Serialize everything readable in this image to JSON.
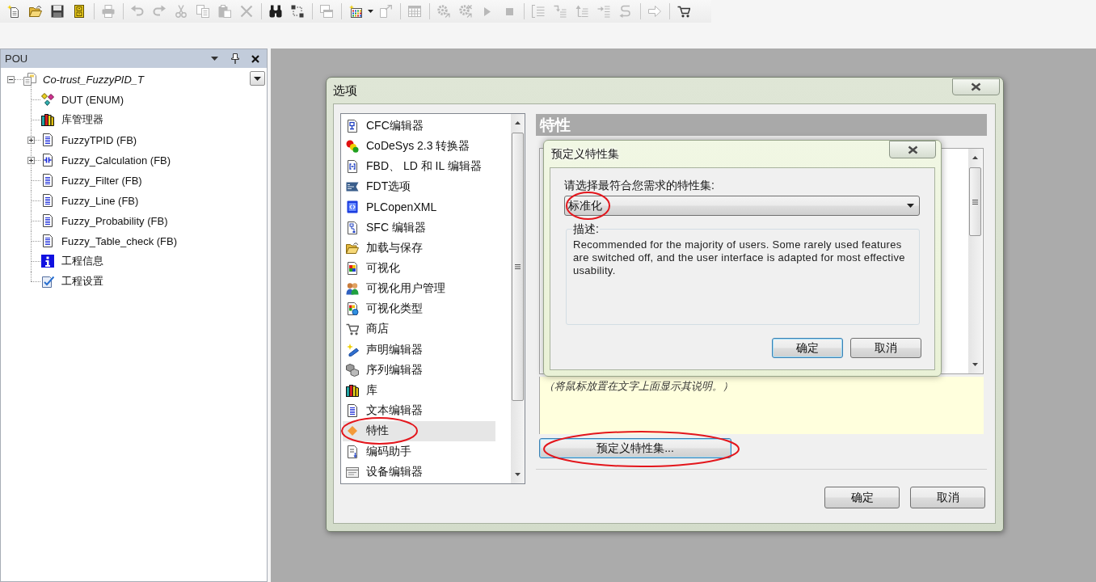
{
  "toolbar": {
    "items": [
      {
        "kind": "new-file",
        "disabled": false
      },
      {
        "kind": "open-folder",
        "disabled": false
      },
      {
        "kind": "save",
        "disabled": false
      },
      {
        "kind": "cabinet",
        "disabled": false
      },
      {
        "kind": "separator"
      },
      {
        "kind": "print",
        "disabled": true
      },
      {
        "kind": "separator"
      },
      {
        "kind": "undo",
        "disabled": true
      },
      {
        "kind": "redo",
        "disabled": true
      },
      {
        "kind": "cut",
        "disabled": true
      },
      {
        "kind": "copy",
        "disabled": true
      },
      {
        "kind": "paste",
        "disabled": true
      },
      {
        "kind": "delete",
        "disabled": true
      },
      {
        "kind": "separator"
      },
      {
        "kind": "find",
        "disabled": false
      },
      {
        "kind": "replace",
        "disabled": false
      },
      {
        "kind": "separator"
      },
      {
        "kind": "windows",
        "disabled": true
      },
      {
        "kind": "separator"
      },
      {
        "kind": "grid-new",
        "disabled": false
      },
      {
        "kind": "caret",
        "disabled": false
      },
      {
        "kind": "page-arrow",
        "disabled": true
      },
      {
        "kind": "separator"
      },
      {
        "kind": "table",
        "disabled": true
      },
      {
        "kind": "separator"
      },
      {
        "kind": "gears",
        "disabled": true
      },
      {
        "kind": "gears-cross",
        "disabled": true
      },
      {
        "kind": "play",
        "disabled": true
      },
      {
        "kind": "stop",
        "disabled": true
      },
      {
        "kind": "separator"
      },
      {
        "kind": "bracket-list",
        "disabled": true
      },
      {
        "kind": "hook-list",
        "disabled": true
      },
      {
        "kind": "up-list",
        "disabled": true
      },
      {
        "kind": "right-list",
        "disabled": true
      },
      {
        "kind": "s-arrow",
        "disabled": true
      },
      {
        "kind": "separator"
      },
      {
        "kind": "arrow-right",
        "disabled": true
      },
      {
        "kind": "separator"
      },
      {
        "kind": "cart",
        "disabled": false
      }
    ]
  },
  "pou_panel": {
    "title": "POU",
    "tree": [
      {
        "label": "Co-trust_FuzzyPID_T",
        "kind": "project",
        "expanded": true,
        "children": [
          {
            "label": "DUT (ENUM)",
            "kind": "dut"
          },
          {
            "label": "库管理器",
            "kind": "library"
          },
          {
            "label": "FuzzyTPID (FB)",
            "kind": "pou",
            "expanded": false
          },
          {
            "label": "Fuzzy_Calculation (FB)",
            "kind": "ladder",
            "expanded": false
          },
          {
            "label": "Fuzzy_Filter (FB)",
            "kind": "pou"
          },
          {
            "label": "Fuzzy_Line (FB)",
            "kind": "pou"
          },
          {
            "label": "Fuzzy_Probability (FB)",
            "kind": "pou"
          },
          {
            "label": "Fuzzy_Table_check (FB)",
            "kind": "pou"
          },
          {
            "label": "工程信息",
            "kind": "info"
          },
          {
            "label": "工程设置",
            "kind": "settings"
          }
        ]
      }
    ]
  },
  "options_dialog": {
    "title": "选项",
    "categories": [
      {
        "label": "CFC编辑器",
        "kind": "cfc",
        "selected": false,
        "circled": false
      },
      {
        "label": "CoDeSys 2.3 转换器",
        "kind": "converter",
        "selected": false,
        "circled": false
      },
      {
        "label": "FBD、 LD 和 IL 编辑器",
        "kind": "fbd",
        "selected": false,
        "circled": false
      },
      {
        "label": "FDT选项",
        "kind": "fdt",
        "selected": false,
        "circled": false
      },
      {
        "label": "PLCopenXML",
        "kind": "xml",
        "selected": false,
        "circled": false
      },
      {
        "label": "SFC 编辑器",
        "kind": "sfc",
        "selected": false,
        "circled": false
      },
      {
        "label": "加载与保存",
        "kind": "folder",
        "selected": false,
        "circled": false
      },
      {
        "label": "可视化",
        "kind": "visual",
        "selected": false,
        "circled": false
      },
      {
        "label": "可视化用户管理",
        "kind": "users",
        "selected": false,
        "circled": false
      },
      {
        "label": "可视化类型",
        "kind": "visual-types",
        "selected": false,
        "circled": false
      },
      {
        "label": "商店",
        "kind": "cart",
        "selected": false,
        "circled": false
      },
      {
        "label": "声明编辑器",
        "kind": "declaration",
        "selected": false,
        "circled": false
      },
      {
        "label": "序列编辑器",
        "kind": "cubes",
        "selected": false,
        "circled": false
      },
      {
        "label": "库",
        "kind": "library",
        "selected": false,
        "circled": false
      },
      {
        "label": "文本编辑器",
        "kind": "text",
        "selected": false,
        "circled": false
      },
      {
        "label": "特性",
        "kind": "diamond",
        "selected": true,
        "circled": true
      },
      {
        "label": "编码助手",
        "kind": "code",
        "selected": false,
        "circled": false
      },
      {
        "label": "设备编辑器",
        "kind": "device",
        "selected": false,
        "circled": false
      }
    ],
    "page": {
      "title": "特性",
      "hint": "（将鼠标放置在文字上面显示其说明。）",
      "preset_button": {
        "label": "预定义特性集...",
        "focused": true,
        "circled": true
      }
    },
    "buttons": [
      {
        "label": "确定",
        "focused": false
      },
      {
        "label": "取消",
        "focused": false
      }
    ]
  },
  "preset_dialog": {
    "title": "预定义特性集",
    "prompt": "请选择最符合您需求的特性集:",
    "selection": {
      "value": "标准化",
      "circled": true
    },
    "description": {
      "label": "描述:",
      "text": "Recommended for the majority of users. Some rarely used features are switched off, and the user interface is adapted for most effective usability."
    },
    "buttons": [
      {
        "label": "确定",
        "focused": true
      },
      {
        "label": "取消",
        "focused": false
      }
    ]
  }
}
